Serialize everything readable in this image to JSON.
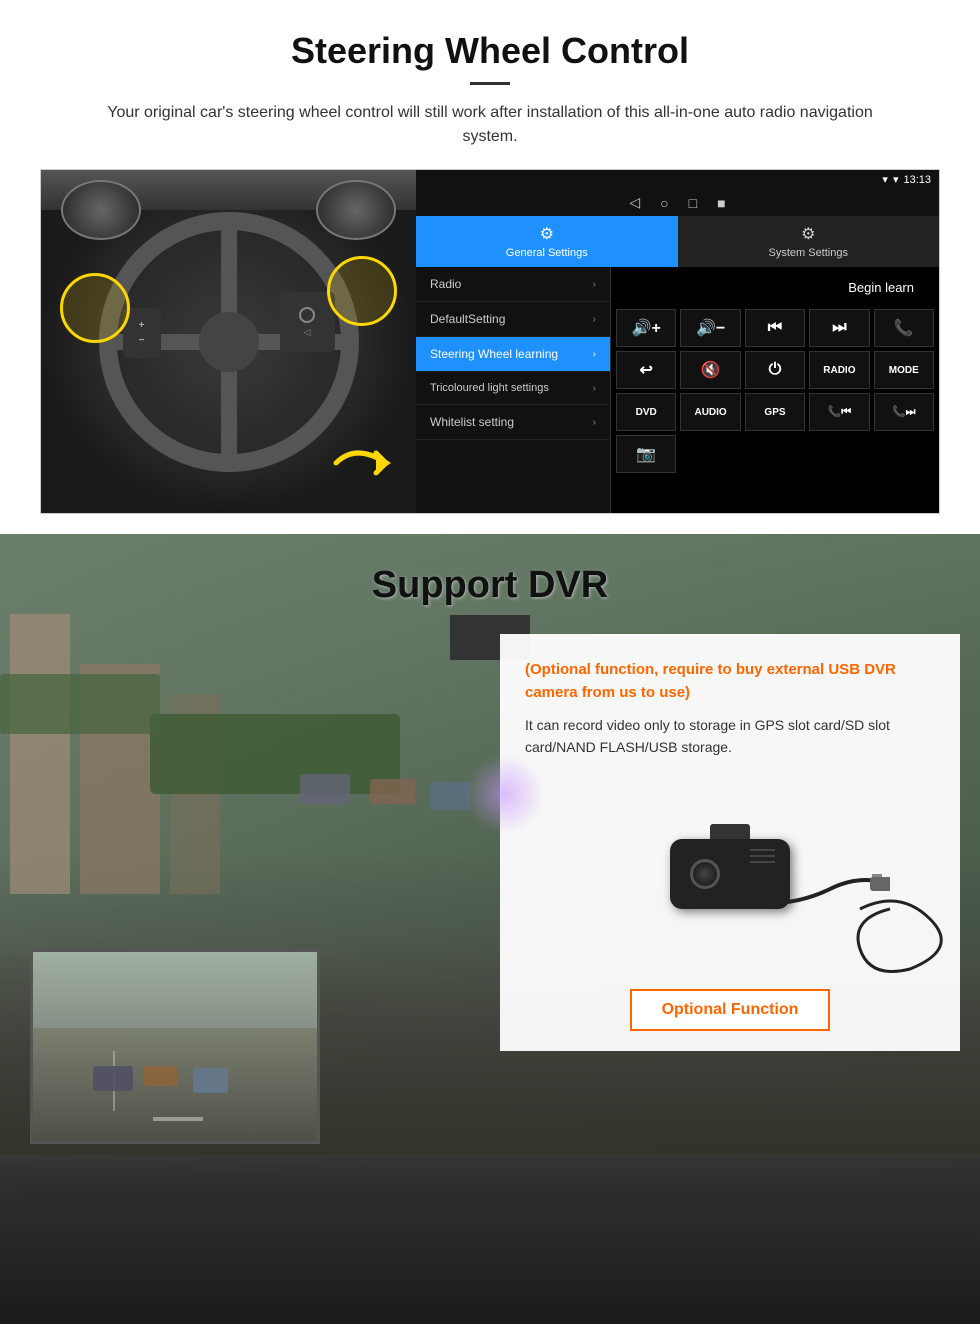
{
  "section1": {
    "title": "Steering Wheel Control",
    "description": "Your original car's steering wheel control will still work after installation of this all-in-one auto radio navigation system.",
    "divider": "—",
    "android_ui": {
      "status_bar": {
        "signal_icon": "▾",
        "wifi_icon": "▾",
        "time": "13:13"
      },
      "nav_icons": [
        "◁",
        "○",
        "□",
        "■"
      ],
      "tabs": [
        {
          "label": "General Settings",
          "icon": "⚙",
          "active": true
        },
        {
          "label": "System Settings",
          "icon": "🔧",
          "active": false
        }
      ],
      "menu_items": [
        {
          "label": "Radio",
          "active": false
        },
        {
          "label": "DefaultSetting",
          "active": false
        },
        {
          "label": "Steering Wheel learning",
          "active": true
        },
        {
          "label": "Tricoloured light settings",
          "active": false
        },
        {
          "label": "Whitelist setting",
          "active": false
        }
      ],
      "begin_learn_label": "Begin learn",
      "control_buttons": [
        "🔊+",
        "🔊−",
        "⏮",
        "⏭",
        "📞",
        "↩",
        "🔇",
        "⏻",
        "RADIO",
        "MODE",
        "DVD",
        "AUDIO",
        "GPS",
        "📞⏮",
        "📞⏭",
        "📷"
      ]
    }
  },
  "section2": {
    "title": "Support DVR",
    "divider": "—",
    "card": {
      "optional_text": "(Optional function, require to buy external USB DVR camera from us to use)",
      "description": "It can record video only to storage in GPS slot card/SD slot card/NAND FLASH/USB storage.",
      "button_label": "Optional Function"
    }
  }
}
